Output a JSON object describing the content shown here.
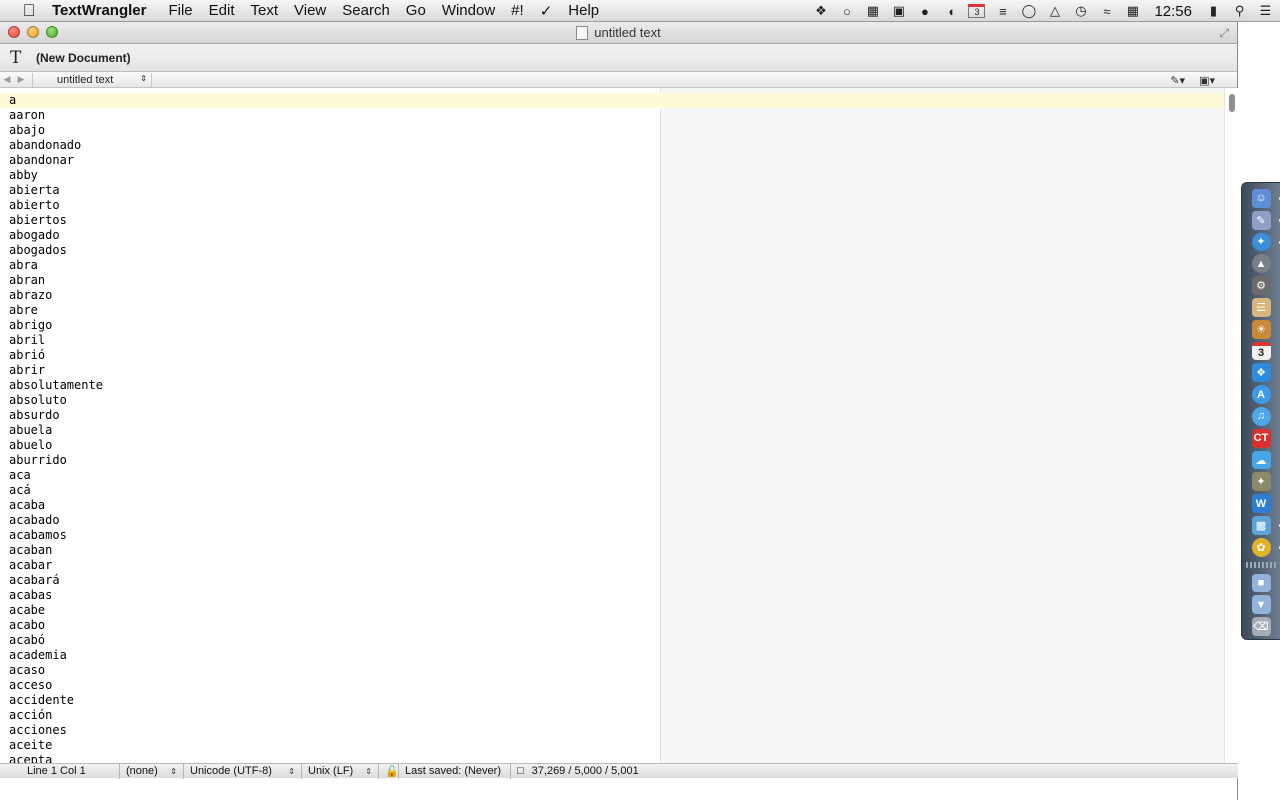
{
  "menubar": {
    "app_name": "TextWrangler",
    "items": [
      "File",
      "Edit",
      "Text",
      "View",
      "Search",
      "Go",
      "Window",
      "#!",
      "Help"
    ],
    "calendar_day": "3",
    "clock": "12:56"
  },
  "window": {
    "title": "untitled text",
    "toolbar_doc_label": "(New Document)",
    "nav_file": "untitled text"
  },
  "editor": {
    "lines": [
      "a",
      "aaron",
      "abajo",
      "abandonado",
      "abandonar",
      "abby",
      "abierta",
      "abierto",
      "abiertos",
      "abogado",
      "abogados",
      "abra",
      "abran",
      "abrazo",
      "abre",
      "abrigo",
      "abril",
      "abrió",
      "abrir",
      "absolutamente",
      "absoluto",
      "absurdo",
      "abuela",
      "abuelo",
      "aburrido",
      "aca",
      "acá",
      "acaba",
      "acabado",
      "acabamos",
      "acaban",
      "acabar",
      "acabará",
      "acabas",
      "acabe",
      "acabo",
      "acabó",
      "academia",
      "acaso",
      "acceso",
      "accidente",
      "acción",
      "acciones",
      "aceite",
      "acepta"
    ]
  },
  "status": {
    "position": "Line 1 Col 1",
    "language": "(none)",
    "encoding": "Unicode (UTF-8)",
    "line_endings": "Unix (LF)",
    "last_saved": "Last saved: (Never)",
    "counts": "37,269 / 5,000 / 5,001"
  },
  "colors": {
    "current_line": "#fffbd6",
    "right_pane": "#f7f7f7"
  }
}
